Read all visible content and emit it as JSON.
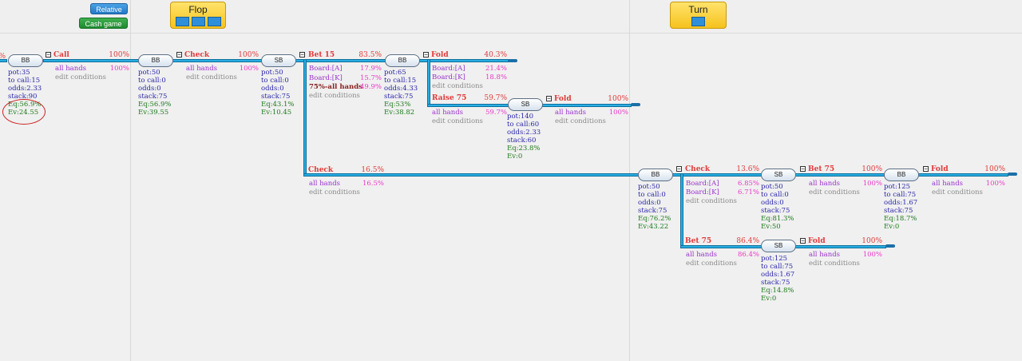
{
  "toolbar": {
    "relative_label": "Relative",
    "cash_label": "Cash game"
  },
  "streets": {
    "flop_label": "Flop",
    "turn_label": "Turn"
  },
  "root": {
    "node_label": "BB",
    "partial_pct": "%",
    "stats": [
      "pot:35",
      "to call:15",
      "odds:2.33",
      "stack:90"
    ],
    "eq": "Eq:56.9%",
    "ev": "Ev:24.55"
  },
  "a_call": {
    "name": "Call",
    "pct": "100%",
    "cond": "all hands",
    "cond_pct": "100%",
    "edit": "edit conditions"
  },
  "n_bb1": {
    "label": "BB",
    "stats": [
      "pot:50",
      "to call:0",
      "odds:0",
      "stack:75"
    ],
    "eq": "Eq:56.9%",
    "ev": "Ev:39.55"
  },
  "a_check1": {
    "name": "Check",
    "pct": "100%",
    "cond": "all hands",
    "cond_pct": "100%",
    "edit": "edit conditions"
  },
  "n_sb1": {
    "label": "SB",
    "stats": [
      "pot:50",
      "to call:0",
      "odds:0",
      "stack:75"
    ],
    "eq": "Eq:43.1%",
    "ev": "Ev:10.45"
  },
  "a_bet15": {
    "name": "Bet 15",
    "pct": "83.5%",
    "cond1": "Board:[A]",
    "cond1_pct": "17.9%",
    "cond2": "Board:[K]",
    "cond2_pct": "15.7%",
    "cond3": "75%-all hands",
    "cond3_pct": "49.9%",
    "edit": "edit conditions"
  },
  "n_bb2": {
    "label": "BB",
    "stats": [
      "pot:65",
      "to call:15",
      "odds:4.33",
      "stack:75"
    ],
    "eq": "Eq:53%",
    "ev": "Ev:38.82"
  },
  "a_fold1": {
    "name": "Fold",
    "pct": "40.3%",
    "cond1": "Board:[A]",
    "cond1_pct": "21.4%",
    "cond2": "Board:[K]",
    "cond2_pct": "18.8%",
    "edit": "edit conditions"
  },
  "a_raise75": {
    "name": "Raise 75",
    "pct": "59.7%",
    "cond": "all hands",
    "cond_pct": "59.7%",
    "edit": "edit conditions"
  },
  "n_sb2": {
    "label": "SB",
    "stats": [
      "pot:140",
      "to call:60",
      "odds:2.33",
      "stack:60"
    ],
    "eq": "Eq:23.8%",
    "ev": "Ev:0"
  },
  "a_fold2": {
    "name": "Fold",
    "pct": "100%",
    "cond": "all hands",
    "cond_pct": "100%",
    "edit": "edit conditions"
  },
  "a_check2": {
    "name": "Check",
    "pct": "16.5%",
    "cond": "all hands",
    "cond_pct": "16.5%",
    "edit": "edit conditions"
  },
  "n_bb3": {
    "label": "BB",
    "stats": [
      "pot:50",
      "to call:0",
      "odds:0",
      "stack:75"
    ],
    "eq": "Eq:76.2%",
    "ev": "Ev:43.22"
  },
  "a_check3": {
    "name": "Check",
    "pct": "13.6%",
    "cond1": "Board:[A]",
    "cond1_pct": "6.85%",
    "cond2": "Board:[K]",
    "cond2_pct": "6.71%",
    "edit": "edit conditions"
  },
  "n_sb3": {
    "label": "SB",
    "stats": [
      "pot:50",
      "to call:0",
      "odds:0",
      "stack:75"
    ],
    "eq": "Eq:81.3%",
    "ev": "Ev:50"
  },
  "a_bet75a": {
    "name": "Bet 75",
    "pct": "100%",
    "cond": "all hands",
    "cond_pct": "100%",
    "edit": "edit conditions"
  },
  "n_bb4": {
    "label": "BB",
    "stats": [
      "pot:125",
      "to call:75",
      "odds:1.67",
      "stack:75"
    ],
    "eq": "Eq:18.7%",
    "ev": "Ev:0"
  },
  "a_fold3": {
    "name": "Fold",
    "pct": "100%",
    "cond": "all hands",
    "cond_pct": "100%",
    "edit": "edit conditions"
  },
  "a_bet75b": {
    "name": "Bet 75",
    "pct": "86.4%",
    "cond": "all hands",
    "cond_pct": "86.4%",
    "edit": "edit conditions"
  },
  "n_sb4": {
    "label": "SB",
    "stats": [
      "pot:125",
      "to call:75",
      "odds:1.67",
      "stack:75"
    ],
    "eq": "Eq:14.8%",
    "ev": "Ev:0"
  },
  "a_fold4": {
    "name": "Fold",
    "pct": "100%",
    "cond": "all hands",
    "cond_pct": "100%",
    "edit": "edit conditions"
  }
}
